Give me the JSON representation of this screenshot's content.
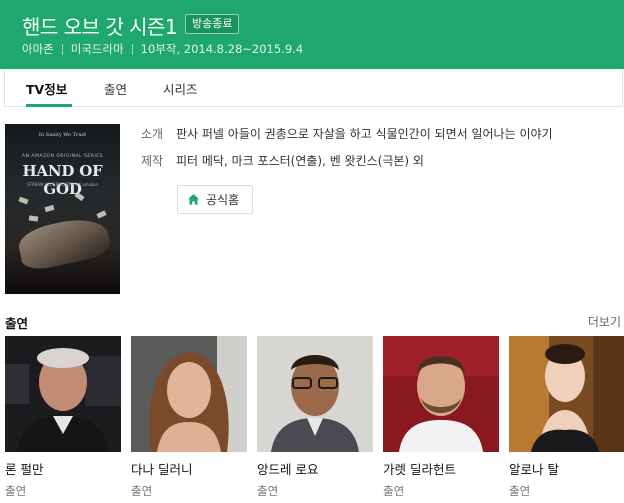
{
  "header": {
    "title": "핸드 오브 갓 시즌1",
    "badge": "방송종료",
    "network": "아마존",
    "genre": "미국드라마",
    "schedule": "10부작, 2014.8.28~2015.9.4",
    "accent_color": "#1ea86d"
  },
  "tabs": [
    {
      "label": "TV정보",
      "active": true
    },
    {
      "label": "출연",
      "active": false
    },
    {
      "label": "시리즈",
      "active": false
    }
  ],
  "poster": {
    "tagline": "In Sanity We Trust",
    "studio": "AN AMAZON ORIGINAL SERIES",
    "title": "HAND OF GOD",
    "subtitle": "STREAM ALL EPISODES 9/4 amazon"
  },
  "info": {
    "synopsis_label": "소개",
    "synopsis": "판사 퍼넬 아들이 권총으로 자살을 하고 식물인간이 되면서 일어나는 이야기",
    "production_label": "제작",
    "production": "피터 메닥, 마크 포스터(연출), 벤 왓킨스(극본) 외",
    "official_button": "공식홈",
    "official_icon": "home-icon"
  },
  "cast_section": {
    "title": "출연",
    "more": "더보기",
    "members": [
      {
        "name": "론 펄만",
        "role": "출연"
      },
      {
        "name": "다나 딜러니",
        "role": "출연"
      },
      {
        "name": "앙드레 로요",
        "role": "출연"
      },
      {
        "name": "가렛 딜라헌트",
        "role": "출연"
      },
      {
        "name": "알로나 탈",
        "role": "출연"
      }
    ]
  }
}
